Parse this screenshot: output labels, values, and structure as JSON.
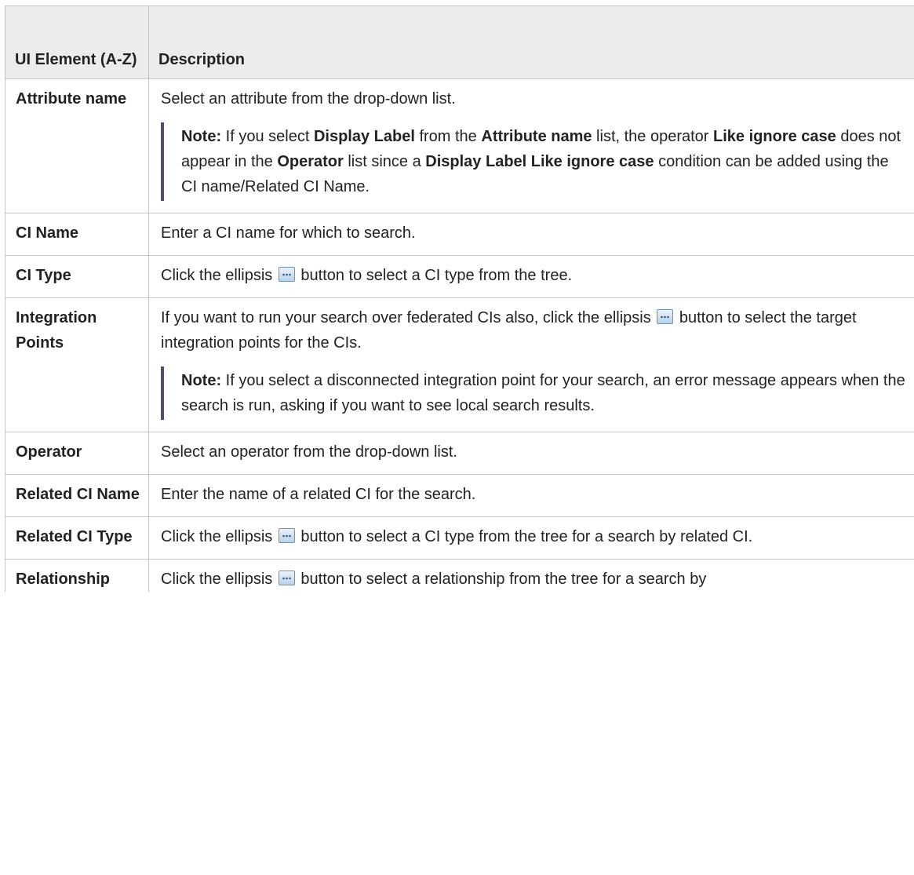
{
  "headers": {
    "col1": "UI Element (A-Z)",
    "col2": "Description"
  },
  "rows": {
    "attribute_name": {
      "name": "Attribute name",
      "desc": "Select an attribute from the drop-down list.",
      "note": {
        "label": "Note:",
        "t1": " If you select ",
        "b1": "Display Label",
        "t2": " from the ",
        "b2": "Attribute name",
        "t3": " list, the operator ",
        "b3": "Like ignore case",
        "t4": " does not appear in the ",
        "b4": "Operator",
        "t5": " list since a ",
        "b5": "Display Label Like ignore case",
        "t6": " condition can be added using the CI name/Related CI Name."
      }
    },
    "ci_name": {
      "name": "CI Name",
      "desc": "Enter a CI name for which to search."
    },
    "ci_type": {
      "name": "CI Type",
      "desc_before": "Click the ellipsis ",
      "desc_after": " button to select a CI type from the tree."
    },
    "integration_points": {
      "name": "Integration Points",
      "desc_before": "If you want to run your search over federated CIs also, click the ellipsis ",
      "desc_after": " button to select the target integration points for the CIs.",
      "note": {
        "label": "Note:",
        "text": " If you select a disconnected integration point for your search, an error message appears when the search is run, asking if you want to see local search results."
      }
    },
    "operator": {
      "name": "Operator",
      "desc": "Select an operator from the drop-down list."
    },
    "related_ci_name": {
      "name": "Related CI Name",
      "desc": "Enter the name of a related CI for the search."
    },
    "related_ci_type": {
      "name": "Related CI Type",
      "desc_before": "Click the ellipsis ",
      "desc_after": " button to select a CI type from the tree for a search by related CI."
    },
    "relationship": {
      "name": "Relationship",
      "desc_before": "Click the ellipsis ",
      "desc_after": " button to select a relationship from the tree for a search by"
    }
  },
  "icons": {
    "ellipsis": "ellipsis-button-icon"
  },
  "colors": {
    "header_bg": "#ececec",
    "border": "#c4c4c4",
    "note_bar": "#5b4670",
    "icon_border": "#6d93b9"
  }
}
